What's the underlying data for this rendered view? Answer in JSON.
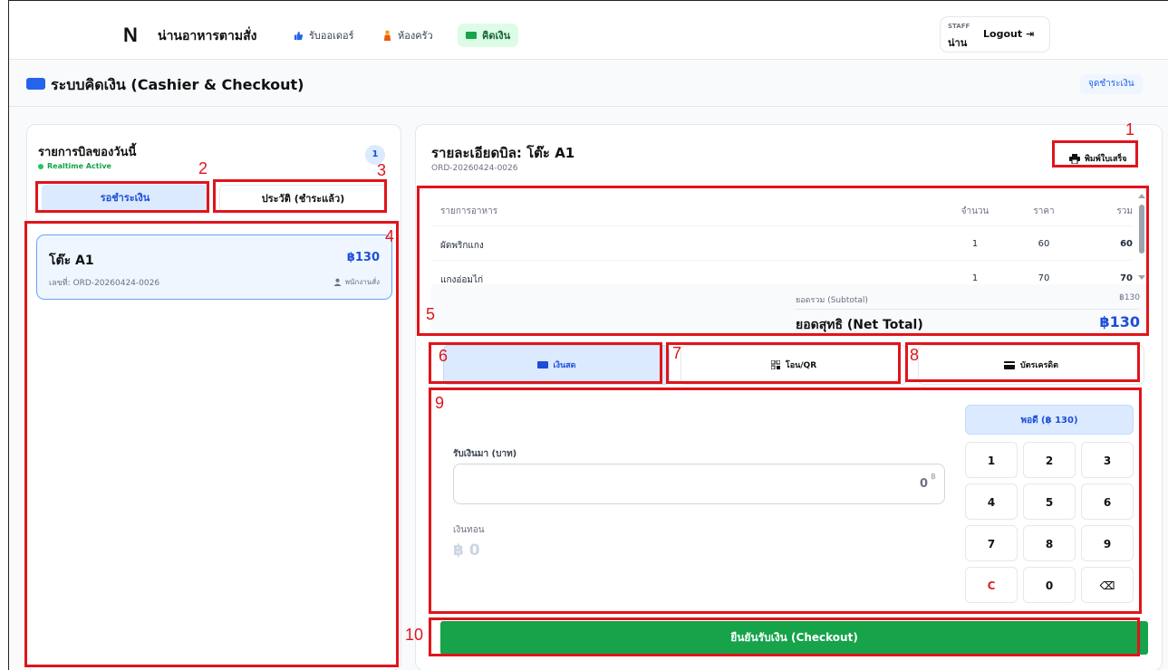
{
  "nav": {
    "logo": "N",
    "brand": "น่านอาหารตามสั่ง",
    "links": [
      {
        "label": "รับออเดอร์",
        "icon": "thumbs-up-icon"
      },
      {
        "label": "ห้องครัว",
        "icon": "chef-icon"
      },
      {
        "label": "คิดเงิน",
        "icon": "cash-icon"
      }
    ],
    "user": {
      "role": "STAFF",
      "name": "น่าน",
      "logout": "Logout"
    }
  },
  "page": {
    "title": "ระบบคิดเงิน (Cashier & Checkout)",
    "badge": "จุดชำระเงิน"
  },
  "left": {
    "title": "รายการบิลของวันนี้",
    "realtime": "Realtime Active",
    "count": "1",
    "tabs": {
      "pending": "รอชำระเงิน",
      "history": "ประวัติ (ชำระแล้ว)"
    },
    "bill": {
      "table": "โต๊ะ A1",
      "amount": "฿130",
      "order_no": "เลขที่: ORD-20260424-0026",
      "staff": "พนักงานสั่ง"
    }
  },
  "detail": {
    "title": "รายละเอียดบิล: โต๊ะ A1",
    "order_id": "ORD-20260424-0026",
    "print": "พิมพ์ใบเสร็จ",
    "headers": {
      "item": "รายการอาหาร",
      "qty": "จำนวน",
      "price": "ราคา",
      "total": "รวม"
    },
    "items": [
      {
        "name": "ผัดพริกแกง",
        "qty": "1",
        "price": "60",
        "total": "60"
      },
      {
        "name": "แกงอ่อมไก่",
        "qty": "1",
        "price": "70",
        "total": "70"
      }
    ],
    "subtotal_label": "ยอดรวม (Subtotal)",
    "subtotal": "฿130",
    "net_label": "ยอดสุทธิ (Net Total)",
    "net": "฿130"
  },
  "payment": {
    "cash": "เงินสด",
    "qr": "โอน/QR",
    "card": "บัตรเครดิต",
    "received_label": "รับเงินมา (บาท)",
    "received_value": "0",
    "received_unit": "฿",
    "change_label": "เงินทอน",
    "change_value": "฿ 0",
    "exact": "พอดี (฿ 130)",
    "keys": [
      "1",
      "2",
      "3",
      "4",
      "5",
      "6",
      "7",
      "8",
      "9",
      "C",
      "0",
      "⌫"
    ],
    "checkout": "ยืนยันรับเงิน (Checkout)"
  },
  "annotations": [
    "1",
    "2",
    "3",
    "4",
    "5",
    "6",
    "7",
    "8",
    "9",
    "10"
  ],
  "colors": {
    "primary": "#2563eb",
    "success": "#16a34a",
    "annotation": "#e0141b"
  }
}
